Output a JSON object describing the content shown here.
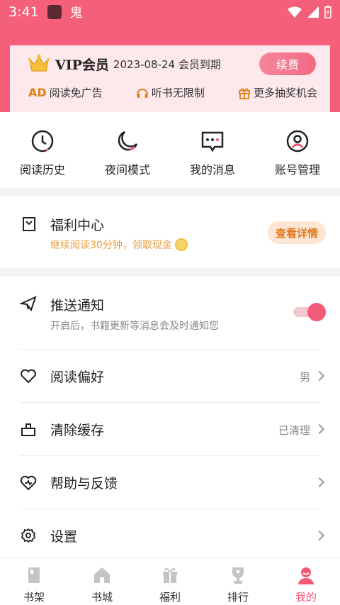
{
  "status": {
    "time": "3:41",
    "glyph": "鬼"
  },
  "vip": {
    "title": "VIP会员",
    "expire": "2023-08-24 会员到期",
    "renew_label": "续费",
    "benefits": [
      {
        "icon": "ad-icon",
        "tag": "AD",
        "label": "阅读免广告"
      },
      {
        "icon": "headphones-icon",
        "label": "听书无限制"
      },
      {
        "icon": "gift-icon",
        "label": "更多抽奖机会"
      }
    ]
  },
  "quick": [
    {
      "icon": "clock-icon",
      "label": "阅读历史"
    },
    {
      "icon": "moon-icon",
      "label": "夜间模式"
    },
    {
      "icon": "message-icon",
      "label": "我的消息"
    },
    {
      "icon": "account-icon",
      "label": "账号管理"
    }
  ],
  "welfare": {
    "title": "福利中心",
    "subtitle": "继续阅读30分钟，领取现金",
    "button": "查看详情"
  },
  "settings": {
    "push": {
      "title": "推送通知",
      "subtitle": "开启后，书籍更新等消息会及时通知您",
      "enabled": true
    },
    "preference": {
      "title": "阅读偏好",
      "value": "男"
    },
    "cache": {
      "title": "清除缓存",
      "value": "已清理"
    },
    "help": {
      "title": "帮助与反馈"
    },
    "settings": {
      "title": "设置"
    }
  },
  "tabs": [
    {
      "icon": "bookshelf-icon",
      "label": "书架"
    },
    {
      "icon": "bookstore-icon",
      "label": "书城"
    },
    {
      "icon": "welfare-icon",
      "label": "福利"
    },
    {
      "icon": "ranking-icon",
      "label": "排行"
    },
    {
      "icon": "profile-icon",
      "label": "我的"
    }
  ],
  "colors": {
    "brand": "#f46079",
    "accent_orange": "#e2791d"
  }
}
